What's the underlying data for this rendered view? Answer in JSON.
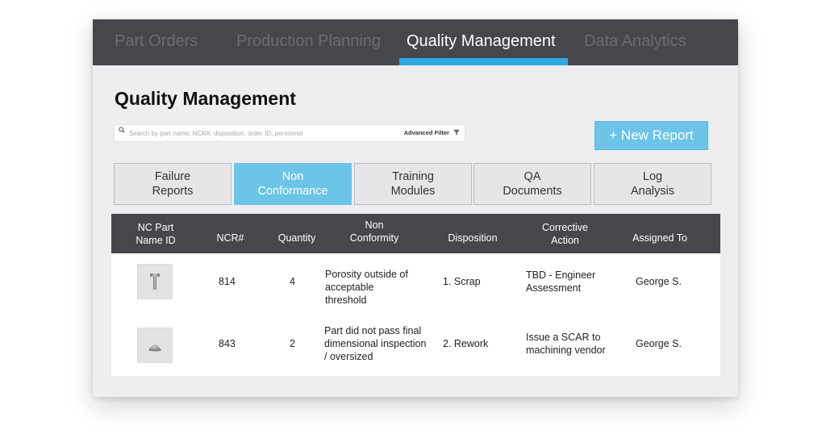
{
  "nav": {
    "tabs": [
      "Part Orders",
      "Production Planning",
      "Quality Management",
      "Data Analytics"
    ],
    "active_tab": "Quality Management"
  },
  "page_title": "Quality Management",
  "search": {
    "placeholder": "Search by part name, NCR#, disposition, order ID, personnel",
    "advanced_filter_label": "Advanced Filter"
  },
  "new_report_label": "+ New Report",
  "categories": [
    {
      "line1": "Failure",
      "line2": "Reports"
    },
    {
      "line1": "Non",
      "line2": "Conformance"
    },
    {
      "line1": "Training",
      "line2": "Modules"
    },
    {
      "line1": "QA",
      "line2": "Documents"
    },
    {
      "line1": "Log",
      "line2": "Analysis"
    }
  ],
  "active_category": "Non Conformance",
  "table": {
    "headers": [
      {
        "line1": "NC Part",
        "line2": "Name ID"
      },
      {
        "line1": "NCR#",
        "line2": ""
      },
      {
        "line1": "Quantity",
        "line2": ""
      },
      {
        "line1": "Non",
        "line2": "Conformity"
      },
      {
        "line1": "Disposition",
        "line2": ""
      },
      {
        "line1": "Corrective",
        "line2": "Action"
      },
      {
        "line1": "Assigned To",
        "line2": ""
      }
    ],
    "rows": [
      {
        "thumbnail": "bolt-part-icon",
        "ncr": "814",
        "quantity": "4",
        "nonconformity": [
          "Porosity outside of",
          "acceptable",
          "threshold"
        ],
        "disposition": "1. Scrap",
        "corrective": [
          "TBD - Engineer",
          "Assessment"
        ],
        "assigned": "George S."
      },
      {
        "thumbnail": "dome-part-icon",
        "ncr": "843",
        "quantity": "2",
        "nonconformity": [
          "Part did not pass final",
          "dimensional inspection",
          "/ oversized"
        ],
        "disposition": "2. Rework",
        "corrective": [
          "Issue a SCAR to",
          "machining vendor"
        ],
        "assigned": "George S."
      }
    ]
  },
  "colors": {
    "nav_bg": "#46474c",
    "accent_blue": "#2fa9e3",
    "button_blue": "#6cc4e8",
    "panel_bg": "#eeeef0"
  }
}
